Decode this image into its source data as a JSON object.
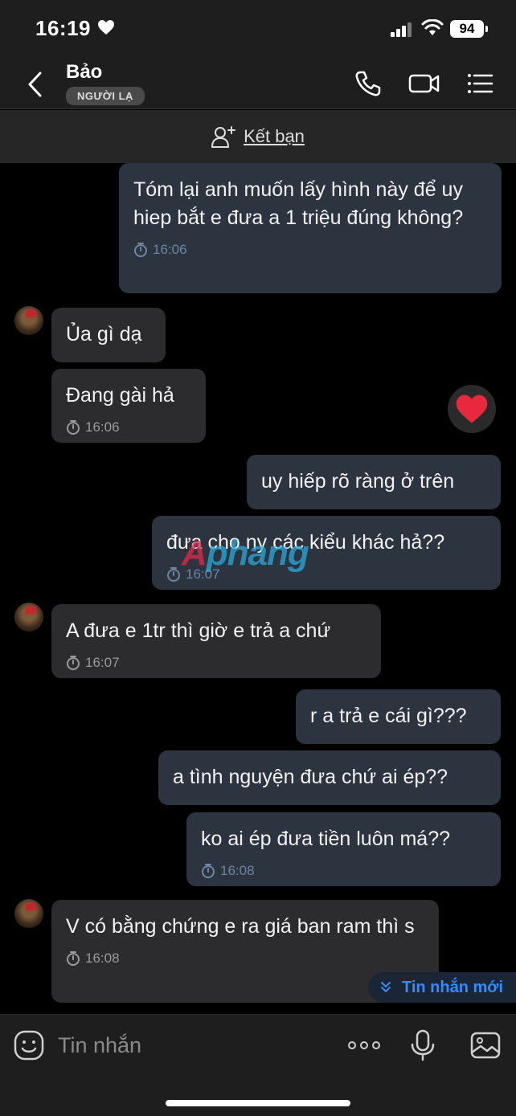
{
  "status_bar": {
    "time": "16:19",
    "battery": "94"
  },
  "header": {
    "contact_name": "Bảo",
    "badge": "NGƯỜI LẠ",
    "icons": [
      "back-icon",
      "phone-icon",
      "video-call-icon",
      "menu-icon"
    ]
  },
  "friend_bar": {
    "label": "Kết bạn"
  },
  "messages": [
    {
      "dir": "out",
      "text": "Tóm lại anh muốn lấy hình này để uy hiep bắt e đưa a 1 triệu đúng không?",
      "time": "16:06"
    },
    {
      "dir": "in",
      "text": "Ủa gì dạ",
      "time": ""
    },
    {
      "dir": "in",
      "text": "Đang gài hả",
      "time": "16:06",
      "reaction": "heart"
    },
    {
      "dir": "out",
      "text": "uy hiếp rõ ràng ở trên",
      "time": ""
    },
    {
      "dir": "out",
      "text": "đưa cho ny các kiểu khác hả??",
      "time": "16:07"
    },
    {
      "dir": "in",
      "text": "A đưa e 1tr thì giờ e trả a chứ",
      "time": "16:07"
    },
    {
      "dir": "out",
      "text": "r a trả e cái gì???",
      "time": ""
    },
    {
      "dir": "out",
      "text": "a tình nguyện đưa chứ ai ép??",
      "time": ""
    },
    {
      "dir": "out",
      "text": "ko ai ép đưa tiền luôn má??",
      "time": "16:08"
    },
    {
      "dir": "in",
      "text": "V có bằng chứng e ra giá ban ram thì s",
      "time": "16:08"
    }
  ],
  "watermark": {
    "part1": "A",
    "part2": "phang"
  },
  "new_messages_label": "Tin nhắn mới",
  "input": {
    "placeholder": "Tin nhắn"
  },
  "colors": {
    "background": "#000000",
    "header": "#1e1e1e",
    "outgoing_bubble": "#2c3440",
    "incoming_bubble": "#2c2c2e",
    "accent": "#2f8dff",
    "reaction": "#e8283c"
  }
}
